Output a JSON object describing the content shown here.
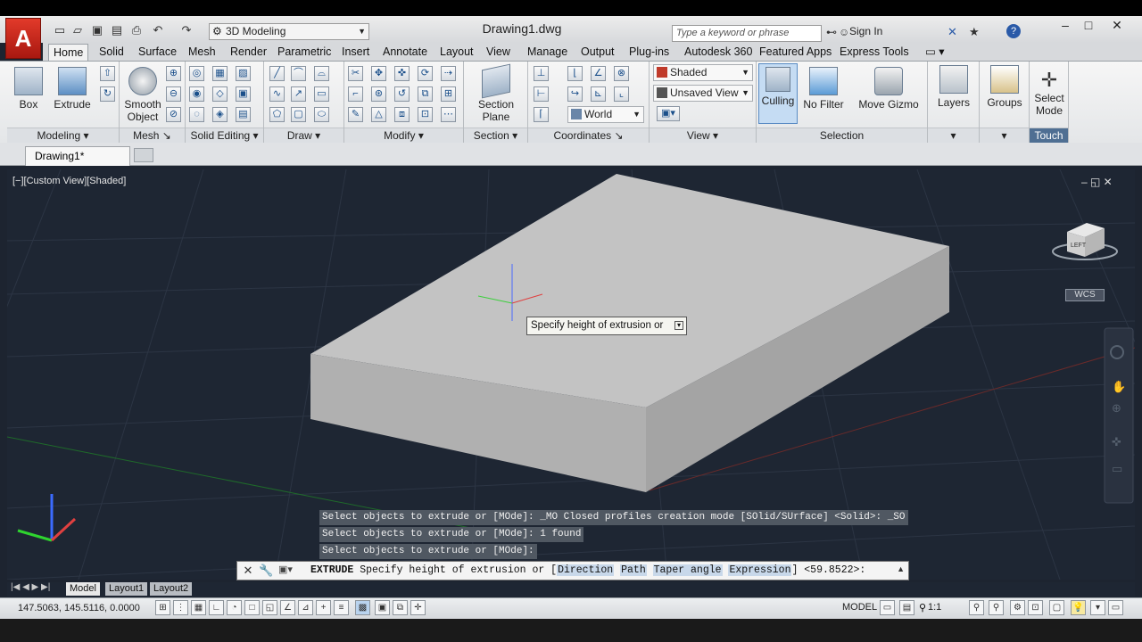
{
  "app": {
    "title": "Drawing1.dwg",
    "workspace": "3D Modeling",
    "search_placeholder": "Type a keyword or phrase",
    "sign_in": "Sign In",
    "logo": "A"
  },
  "tabs": [
    "Home",
    "Solid",
    "Surface",
    "Mesh",
    "Render",
    "Parametric",
    "Insert",
    "Annotate",
    "Layout",
    "View",
    "Manage",
    "Output",
    "Plug-ins",
    "Autodesk 360",
    "Featured Apps",
    "Express Tools"
  ],
  "ribbon": {
    "panels": {
      "modeling": "Modeling",
      "mesh": "Mesh",
      "solid_editing": "Solid Editing",
      "draw": "Draw",
      "modify": "Modify",
      "section": "Section",
      "coordinates": "Coordinates",
      "view": "View",
      "selection": "Selection",
      "touch": "Touch"
    },
    "buttons": {
      "box": "Box",
      "extrude": "Extrude",
      "smooth_object": "Smooth Object",
      "section_plane": "Section Plane",
      "culling": "Culling",
      "no_filter": "No Filter",
      "move_gizmo": "Move Gizmo",
      "layers": "Layers",
      "groups": "Groups",
      "select_mode": "Select Mode"
    },
    "dropdowns": {
      "visual_style": "Shaded",
      "view": "Unsaved View",
      "ucs": "World"
    }
  },
  "file_tab": "Drawing1*",
  "viewport": {
    "label": "[−][Custom View][Shaded]",
    "tooltip": "Specify height of extrusion or",
    "wcs": "WCS",
    "cube_face": "LEFT"
  },
  "command": {
    "history": [
      "Select objects to extrude or [MOde]: _MO Closed profiles creation mode [SOlid/SUrface] <Solid>: _SO",
      "Select objects to extrude or [MOde]: 1 found",
      "Select objects to extrude or [MOde]:"
    ],
    "prompt_cmd": "EXTRUDE",
    "prompt_text": "Specify height of extrusion or",
    "options": [
      "Direction",
      "Path",
      "Taper angle",
      "Expression"
    ],
    "default": "<59.8522>:"
  },
  "layout_tabs": [
    "Model",
    "Layout1",
    "Layout2"
  ],
  "status": {
    "coords": "147.5063, 145.5116, 0.0000",
    "model": "MODEL",
    "scale": "1:1"
  }
}
